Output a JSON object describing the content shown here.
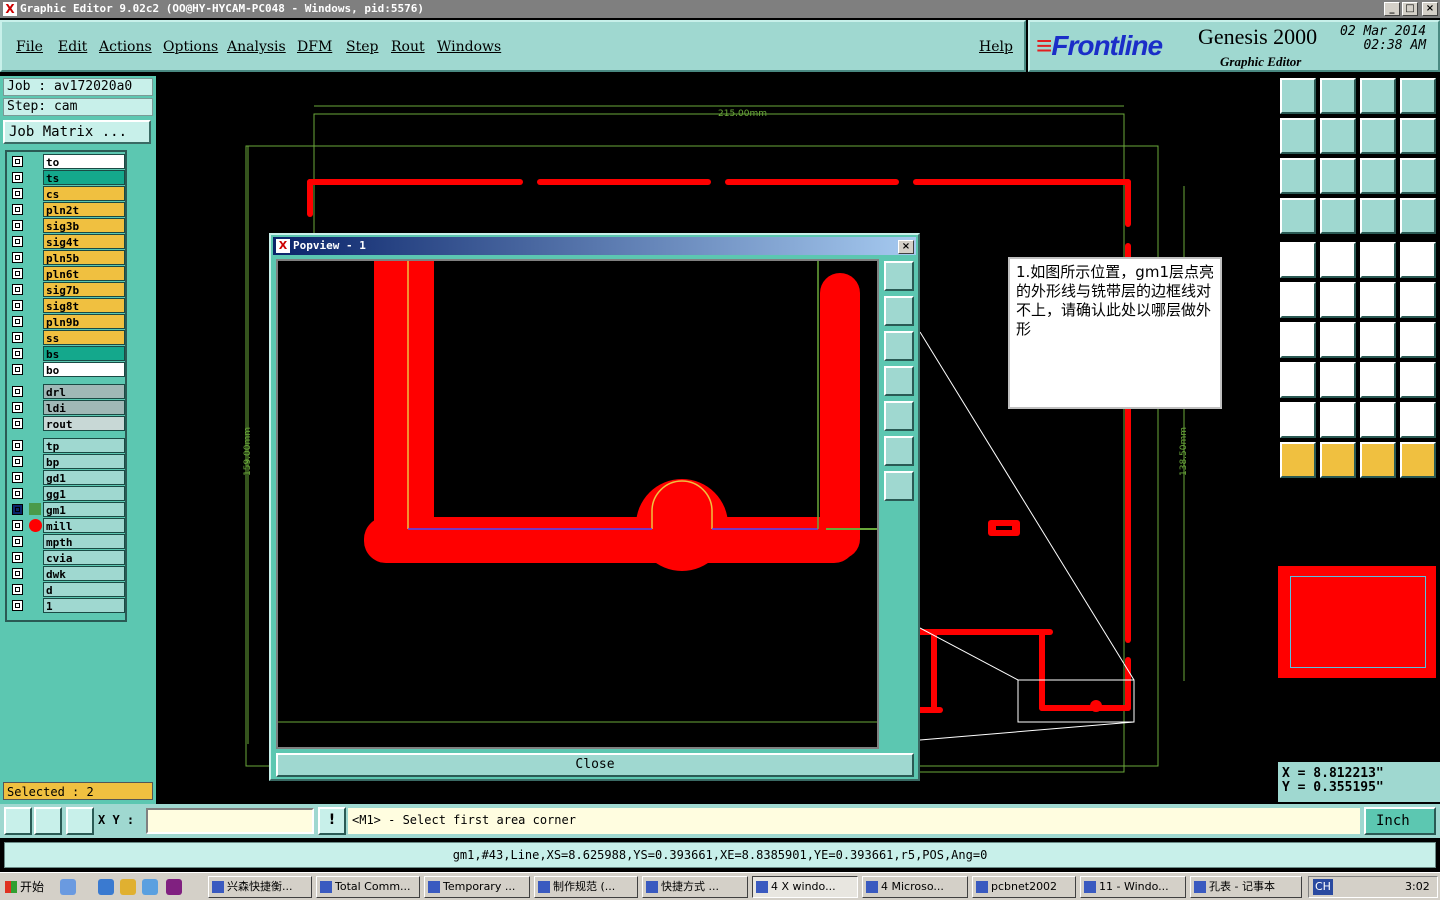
{
  "window": {
    "title": "Graphic Editor 9.02c2  (OO@HY-HYCAM-PC048 - Windows, pid:5576)",
    "minimize": "_",
    "maximize": "□",
    "close": "×",
    "logo": "X"
  },
  "menu": {
    "items": [
      "File",
      "Edit",
      "Actions",
      "Options",
      "Analysis",
      "DFM",
      "Step",
      "Rout",
      "Windows"
    ],
    "help": "Help"
  },
  "brand": {
    "logo": "Frontline",
    "product": "Genesis 2000",
    "subtitle": "Graphic Editor",
    "date": "02 Mar 2014",
    "time": "02:38 AM"
  },
  "job": {
    "job_label": "Job : av172020a0",
    "step_label": "Step: cam",
    "matrix_button": "Job Matrix ..."
  },
  "layers": [
    {
      "name": "to",
      "color": "#ffffff"
    },
    {
      "name": "ts",
      "color": "#14a88c"
    },
    {
      "name": "cs",
      "color": "#f0c040"
    },
    {
      "name": "pln2t",
      "color": "#f0c040"
    },
    {
      "name": "sig3b",
      "color": "#f0c040"
    },
    {
      "name": "sig4t",
      "color": "#f0c040"
    },
    {
      "name": "pln5b",
      "color": "#f0c040"
    },
    {
      "name": "pln6t",
      "color": "#f0c040"
    },
    {
      "name": "sig7b",
      "color": "#f0c040"
    },
    {
      "name": "sig8t",
      "color": "#f0c040"
    },
    {
      "name": "pln9b",
      "color": "#f0c040"
    },
    {
      "name": "ss",
      "color": "#f0c040"
    },
    {
      "name": "bs",
      "color": "#14a88c"
    },
    {
      "name": "bo",
      "color": "#ffffff"
    },
    {
      "name": "drl",
      "color": "#a0b8b6"
    },
    {
      "name": "ldi",
      "color": "#a0b8b6"
    },
    {
      "name": "rout",
      "color": "#c8d8d6"
    },
    {
      "name": "tp",
      "color": "#9fd8d0"
    },
    {
      "name": "bp",
      "color": "#9fd8d0"
    },
    {
      "name": "gd1",
      "color": "#9fd8d0"
    },
    {
      "name": "gg1",
      "color": "#9fd8d0"
    },
    {
      "name": "gm1",
      "color": "#9fd8d0"
    },
    {
      "name": "mill",
      "color": "#9fd8d0"
    },
    {
      "name": "mpth",
      "color": "#9fd8d0"
    },
    {
      "name": "cvia",
      "color": "#9fd8d0"
    },
    {
      "name": "dwk",
      "color": "#9fd8d0"
    },
    {
      "name": "d",
      "color": "#9fd8d0"
    },
    {
      "name": "1",
      "color": "#9fd8d0"
    }
  ],
  "selected": "Selected : 2",
  "canvas": {
    "dim_top": "215.00mm",
    "dim_left": "159.00mm",
    "dim_right": "138.50mm"
  },
  "popup": {
    "title": "Popview - 1",
    "close_label": "Close",
    "close_x": "×",
    "logo": "X"
  },
  "note": {
    "text": "1.如图所示位置，gm1层点亮的外形线与铣带层的边框线对不上，请确认此处以哪层做外形"
  },
  "coords": {
    "x": "X = 8.812213\"",
    "y": "Y = 0.355195\""
  },
  "status": {
    "xy_label": "X Y :",
    "prompt": "<M1> - Select first area corner",
    "unit": "Inch",
    "alert": "!"
  },
  "info": "gm1,#43,Line,XS=8.625988,YS=0.393661,XE=8.8385901,YE=0.393661,r5,POS,Ang=0",
  "taskbar": {
    "start": "开始",
    "tasks": [
      "兴森快捷衡...",
      "Total Comm...",
      "Temporary ...",
      "制作规范 (...",
      "快捷方式 ...",
      "4 X windo...",
      "4 Microso...",
      "pcbnet2002",
      "11 - Windo...",
      "孔表 - 记事本"
    ],
    "clock": "3:02",
    "ime": "CH"
  },
  "colors": {
    "panel": "#9fd8d0",
    "accent_red": "#ff0000",
    "rout_line": "#6aa83a"
  }
}
